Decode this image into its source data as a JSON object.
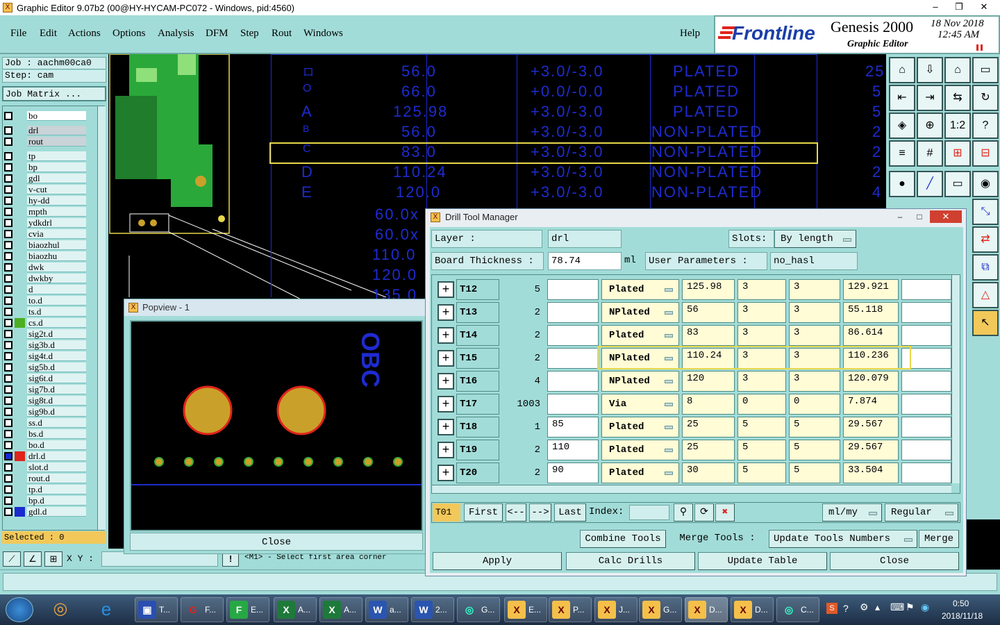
{
  "window": {
    "title": "Graphic Editor 9.07b2 (00@HY-HYCAM-PC072 - Windows, pid:4560)",
    "controls": [
      "–",
      "❐",
      "✕"
    ]
  },
  "menu": [
    "File",
    "Edit",
    "Actions",
    "Options",
    "Analysis",
    "DFM",
    "Step",
    "Rout",
    "Windows"
  ],
  "help": "Help",
  "brand": {
    "logo": "Frontline",
    "product": "Genesis 2000",
    "subtitle": "Graphic Editor",
    "date": "18 Nov 2018",
    "time": "12:45 AM"
  },
  "left": {
    "job": "Job : aachm00ca0",
    "step": "Step: cam",
    "job_matrix": "Job Matrix ...",
    "layers": [
      {
        "name": "bo"
      },
      {
        "name": "drl"
      },
      {
        "name": "rout"
      },
      {
        "name": "tp"
      },
      {
        "name": "bp"
      },
      {
        "name": "gdl"
      },
      {
        "name": "v-cut"
      },
      {
        "name": "hy-dd"
      },
      {
        "name": "mpth"
      },
      {
        "name": "ydkdrl"
      },
      {
        "name": "cvia"
      },
      {
        "name": "biaozhul"
      },
      {
        "name": "biaozhu"
      },
      {
        "name": "dwk"
      },
      {
        "name": "dwkby"
      },
      {
        "name": "d"
      },
      {
        "name": "to.d"
      },
      {
        "name": "ts.d"
      },
      {
        "name": "cs.d"
      },
      {
        "name": "sig2t.d"
      },
      {
        "name": "sig3b.d"
      },
      {
        "name": "sig4t.d"
      },
      {
        "name": "sig5b.d"
      },
      {
        "name": "sig6t.d"
      },
      {
        "name": "sig7b.d"
      },
      {
        "name": "sig8t.d"
      },
      {
        "name": "sig9b.d"
      },
      {
        "name": "ss.d"
      },
      {
        "name": "bs.d"
      },
      {
        "name": "bo.d"
      },
      {
        "name": "drl.d"
      },
      {
        "name": "slot.d"
      },
      {
        "name": "rout.d"
      },
      {
        "name": "tp.d"
      },
      {
        "name": "bp.d"
      },
      {
        "name": "gdl.d"
      }
    ],
    "selected": "Selected : 0"
  },
  "bottom": {
    "xy_label": "X Y :",
    "hint": "<M1> - Select first area corner"
  },
  "bg_table": [
    [
      "ロ",
      "56.0",
      "+3.0/-3.0",
      "PLATED",
      "25"
    ],
    [
      "O",
      "66.0",
      "+0.0/-0.0",
      "PLATED",
      "5"
    ],
    [
      "A",
      "125.98",
      "+3.0/-3.0",
      "PLATED",
      "5"
    ],
    [
      "B",
      "56.0",
      "+3.0/-3.0",
      "NON-PLATED",
      "2"
    ],
    [
      "C",
      "83.0",
      "+3.0/-3.0",
      "NON-PLATED",
      "2"
    ],
    [
      "D",
      "110.24",
      "+3.0/-3.0",
      "NON-PLATED",
      "2"
    ],
    [
      "E",
      "120.0",
      "+3.0/-3.0",
      "NON-PLATED",
      "4"
    ]
  ],
  "bg_partial": [
    "60.0x",
    "60.0x",
    "110.0",
    "120.0",
    "135.0"
  ],
  "popview": {
    "title": "Popview - 1",
    "text": "OBC",
    "close": "Close"
  },
  "dtm": {
    "title": "Drill Tool Manager",
    "layer_label": "Layer :",
    "layer_value": "drl",
    "slots_label": "Slots:",
    "slots_value": "By length",
    "thickness_label": "Board Thickness :",
    "thickness_value": "78.74",
    "thickness_unit": "ml",
    "user_params_label": "User Parameters :",
    "user_params_value": "no_hasl",
    "rows": [
      {
        "tool": "T12",
        "count": "5",
        "finish": "",
        "type": "Plated",
        "size": "125.98",
        "plus": "3",
        "minus": "3",
        "drill": "129.921"
      },
      {
        "tool": "T13",
        "count": "2",
        "finish": "",
        "type": "NPlated",
        "size": "56",
        "plus": "3",
        "minus": "3",
        "drill": "55.118"
      },
      {
        "tool": "T14",
        "count": "2",
        "finish": "",
        "type": "Plated",
        "size": "83",
        "plus": "3",
        "minus": "3",
        "drill": "86.614"
      },
      {
        "tool": "T15",
        "count": "2",
        "finish": "",
        "type": "NPlated",
        "size": "110.24",
        "plus": "3",
        "minus": "3",
        "drill": "110.236"
      },
      {
        "tool": "T16",
        "count": "4",
        "finish": "",
        "type": "NPlated",
        "size": "120",
        "plus": "3",
        "minus": "3",
        "drill": "120.079"
      },
      {
        "tool": "T17",
        "count": "1003",
        "finish": "",
        "type": "Via",
        "size": "8",
        "plus": "0",
        "minus": "0",
        "drill": "7.874"
      },
      {
        "tool": "T18",
        "count": "1",
        "finish": "85",
        "type": "Plated",
        "size": "25",
        "plus": "5",
        "minus": "5",
        "drill": "29.567"
      },
      {
        "tool": "T19",
        "count": "2",
        "finish": "110",
        "type": "Plated",
        "size": "25",
        "plus": "5",
        "minus": "5",
        "drill": "29.567"
      },
      {
        "tool": "T20",
        "count": "2",
        "finish": "90",
        "type": "Plated",
        "size": "30",
        "plus": "5",
        "minus": "5",
        "drill": "33.504"
      }
    ],
    "nav": {
      "current": "T01",
      "first": "First",
      "prev": "<--",
      "next": "-->",
      "last": "Last",
      "index_label": "Index:",
      "units": "ml/my",
      "mode": "Regular"
    },
    "actions1": [
      "Combine Tools",
      "Merge Tools :",
      "Update Tools Numbers",
      "Merge"
    ],
    "actions2": [
      "Apply",
      "Calc Drills",
      "Update Table",
      "Close"
    ]
  },
  "taskbar": {
    "items": [
      "T...",
      "F...",
      "E...",
      "A...",
      "A...",
      "a...",
      "2...",
      "G...",
      "E...",
      "P...",
      "J...",
      "G...",
      "D...",
      "D...",
      "C..."
    ],
    "clock_time": "0:50",
    "clock_date": "2018/11/18"
  },
  "colors": {
    "panel": "#a2dcd8",
    "field": "#cfeeed",
    "cell": "#fffcd6",
    "drill_blue": "#1e2bd0",
    "highlight": "#e8d84a"
  }
}
